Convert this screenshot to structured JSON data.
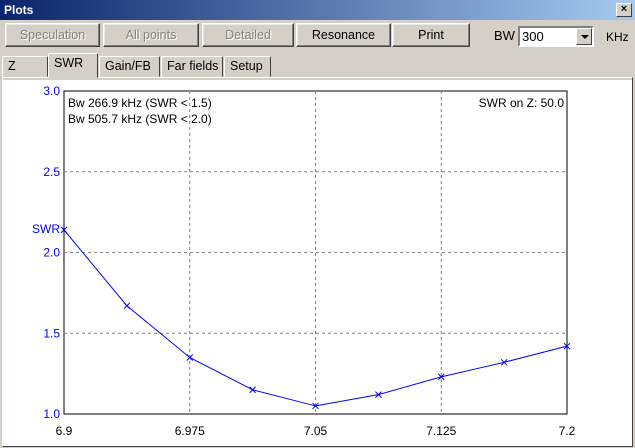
{
  "window": {
    "title": "Plots",
    "close_label": "×"
  },
  "toolbar": {
    "buttons": [
      {
        "label": "Speculation",
        "enabled": false
      },
      {
        "label": "All points",
        "enabled": false
      },
      {
        "label": "Detailed",
        "enabled": false
      },
      {
        "label": "Resonance",
        "enabled": true
      },
      {
        "label": "Print",
        "enabled": true
      }
    ],
    "bw_label": "BW",
    "bw_value": "300",
    "bw_unit": "KHz"
  },
  "tabs": [
    {
      "label": "Z",
      "active": false
    },
    {
      "label": "SWR",
      "active": true
    },
    {
      "label": "Gain/FB",
      "active": false
    },
    {
      "label": "Far fields",
      "active": false
    },
    {
      "label": "Setup",
      "active": false
    }
  ],
  "chart_data": {
    "type": "line",
    "ylabel": "SWR",
    "xlabel": "",
    "xlim": [
      6.9,
      7.2
    ],
    "ylim": [
      1.0,
      3.0
    ],
    "x_ticks": [
      "6.9",
      "6.975",
      "7.05",
      "7.125",
      "7.2"
    ],
    "y_ticks": [
      "1.0",
      "1.5",
      "2.0",
      "2.5",
      "3.0"
    ],
    "grid": true,
    "annotations": [
      "Bw 266.9 kHz (SWR < 1.5)",
      "Bw 505.7 kHz (SWR < 2.0)",
      "SWR on Z: 50.0"
    ],
    "series": [
      {
        "color": "#0000ff",
        "x": [
          6.9,
          6.9375,
          6.975,
          7.0125,
          7.05,
          7.0875,
          7.125,
          7.1625,
          7.2
        ],
        "y": [
          2.14,
          1.67,
          1.35,
          1.15,
          1.05,
          1.12,
          1.23,
          1.32,
          1.42
        ]
      }
    ]
  }
}
